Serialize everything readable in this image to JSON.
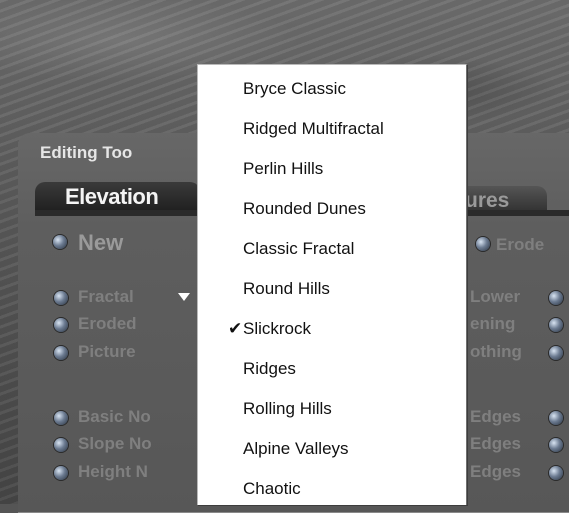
{
  "panel": {
    "title": "Editing Too",
    "tabs": {
      "elevation": "Elevation",
      "textures": "tures"
    },
    "new_label": "New",
    "erode_label": "Erode",
    "left_options": [
      "Fractal",
      "Eroded",
      "Picture"
    ],
    "left_noise": [
      "Basic No",
      "Slope No",
      "Height N"
    ],
    "right_options": [
      "Lower",
      "ening",
      "othing"
    ],
    "right_edges": [
      "Edges",
      "Edges",
      "Edges"
    ],
    "dropdown_arrow": "chevron-down-icon"
  },
  "menu": {
    "items": [
      {
        "label": "Bryce Classic"
      },
      {
        "label": "Ridged Multifractal"
      },
      {
        "label": "Perlin Hills"
      },
      {
        "label": "Rounded Dunes"
      },
      {
        "label": "Classic Fractal"
      },
      {
        "label": "Round Hills"
      },
      {
        "label": "Slickrock",
        "checked": "✔"
      },
      {
        "label": "Ridges"
      },
      {
        "label": "Rolling Hills"
      },
      {
        "label": "Alpine Valleys"
      },
      {
        "label": "Chaotic"
      }
    ]
  }
}
